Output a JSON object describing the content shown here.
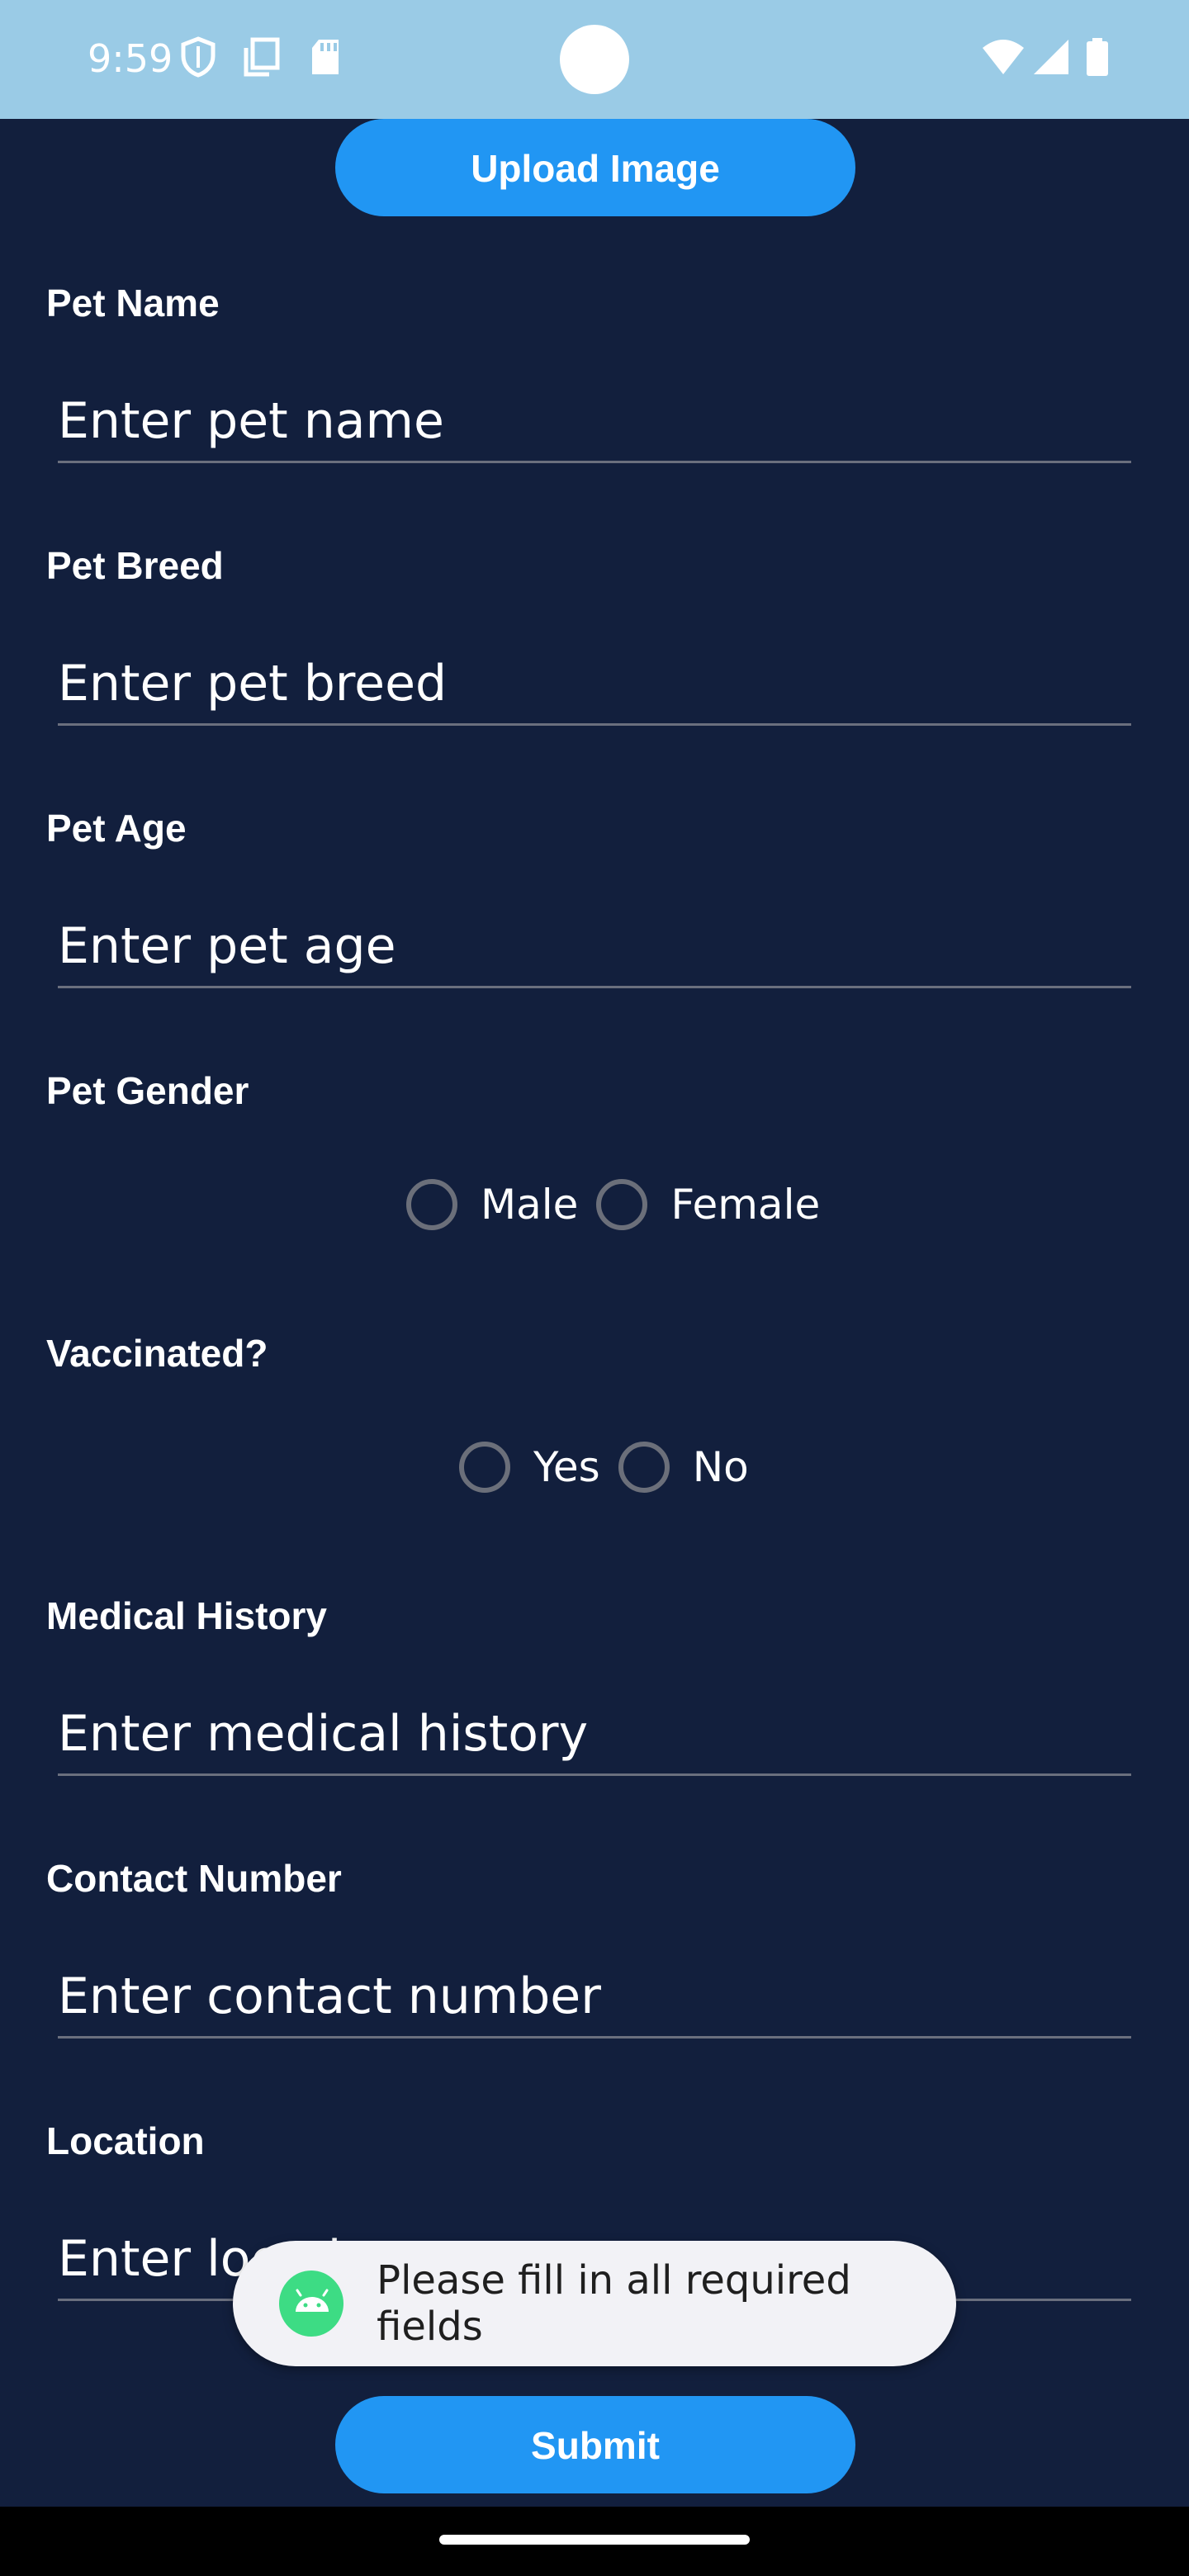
{
  "status_bar": {
    "time": "9:59",
    "icons": [
      "shield-icon",
      "copy-icon",
      "sd-card-icon",
      "wifi-icon",
      "signal-icon",
      "battery-icon"
    ]
  },
  "form": {
    "upload_button": "Upload Image",
    "pet_name": {
      "label": "Pet Name",
      "placeholder": "Enter pet name"
    },
    "pet_breed": {
      "label": "Pet Breed",
      "placeholder": "Enter pet breed"
    },
    "pet_age": {
      "label": "Pet Age",
      "placeholder": "Enter pet age"
    },
    "pet_gender": {
      "label": "Pet Gender",
      "options": [
        "Male",
        "Female"
      ]
    },
    "vaccinated": {
      "label": "Vaccinated?",
      "options": [
        "Yes",
        "No"
      ]
    },
    "medical_history": {
      "label": "Medical History",
      "placeholder": "Enter medical history"
    },
    "contact_number": {
      "label": "Contact Number",
      "placeholder": "Enter contact number"
    },
    "location": {
      "label": "Location",
      "placeholder": "Enter location"
    },
    "submit_button": "Submit"
  },
  "toast": {
    "message": "Please fill in all required fields"
  },
  "colors": {
    "background": "#121f3d",
    "status_bar": "#9acbe6",
    "accent": "#2196f3",
    "toast_bg": "#f2f2f6",
    "android_green": "#3ddc84"
  }
}
